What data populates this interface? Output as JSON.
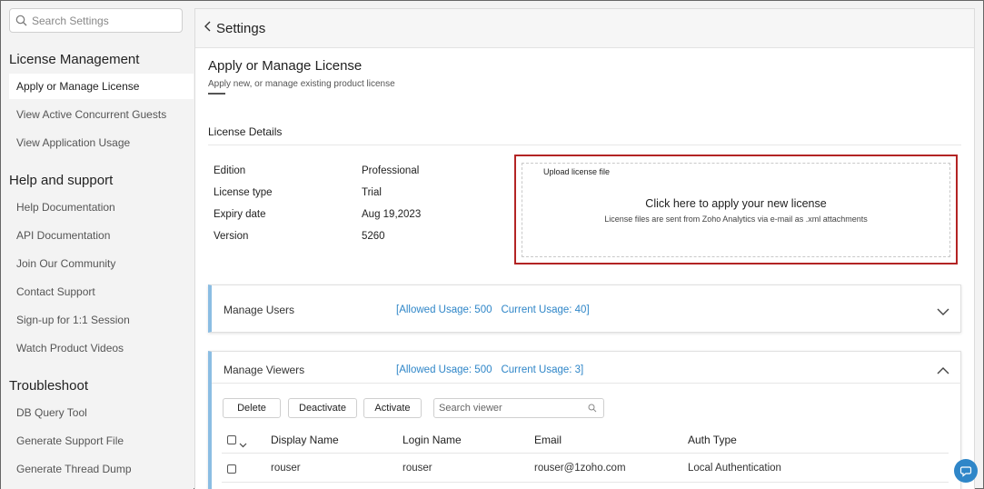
{
  "sidebar": {
    "search_placeholder": "Search Settings",
    "sections": [
      {
        "title": "License Management",
        "items": [
          {
            "label": "Apply or Manage License"
          },
          {
            "label": "View Active Concurrent Guests"
          },
          {
            "label": "View Application Usage"
          }
        ]
      },
      {
        "title": "Help and support",
        "items": [
          {
            "label": "Help Documentation"
          },
          {
            "label": "API Documentation"
          },
          {
            "label": "Join Our Community"
          },
          {
            "label": "Contact Support"
          },
          {
            "label": "Sign-up for 1:1 Session"
          },
          {
            "label": "Watch Product Videos"
          }
        ]
      },
      {
        "title": "Troubleshoot",
        "items": [
          {
            "label": "DB Query Tool"
          },
          {
            "label": "Generate Support File"
          },
          {
            "label": "Generate Thread Dump"
          }
        ]
      }
    ]
  },
  "header": {
    "back_icon": "chevron-left-icon",
    "title": "Settings"
  },
  "page": {
    "title": "Apply or Manage License",
    "subtitle": "Apply new, or manage existing product license"
  },
  "license_details": {
    "title": "License Details",
    "rows": [
      {
        "key": "Edition",
        "value": "Professional"
      },
      {
        "key": "License type",
        "value": "Trial"
      },
      {
        "key": "Expiry date",
        "value": "Aug 19,2023"
      },
      {
        "key": "Version",
        "value": "5260"
      }
    ]
  },
  "upload": {
    "legend": "Upload license file",
    "main": "Click here to apply your new license",
    "hint": "License files are sent from Zoho Analytics via e-mail as .xml attachments"
  },
  "manage_users": {
    "title": "Manage Users",
    "allowed": "[Allowed Usage: 500",
    "current": "Current Usage: 40]"
  },
  "manage_viewers": {
    "title": "Manage Viewers",
    "allowed": "[Allowed Usage: 500",
    "current": "Current Usage: 3]",
    "buttons": {
      "delete": "Delete",
      "deactivate": "Deactivate",
      "activate": "Activate"
    },
    "search_placeholder": "Search viewer",
    "columns": [
      "Display Name",
      "Login Name",
      "Email",
      "Auth Type"
    ],
    "rows": [
      {
        "display_name": "rouser",
        "login_name": "rouser",
        "email": "rouser@1zoho.com",
        "auth_type": "Local Authentication"
      }
    ]
  },
  "colors": {
    "accent": "#2f86c8",
    "highlight_border": "#b32424",
    "panel_accent": "#8bbde3"
  }
}
